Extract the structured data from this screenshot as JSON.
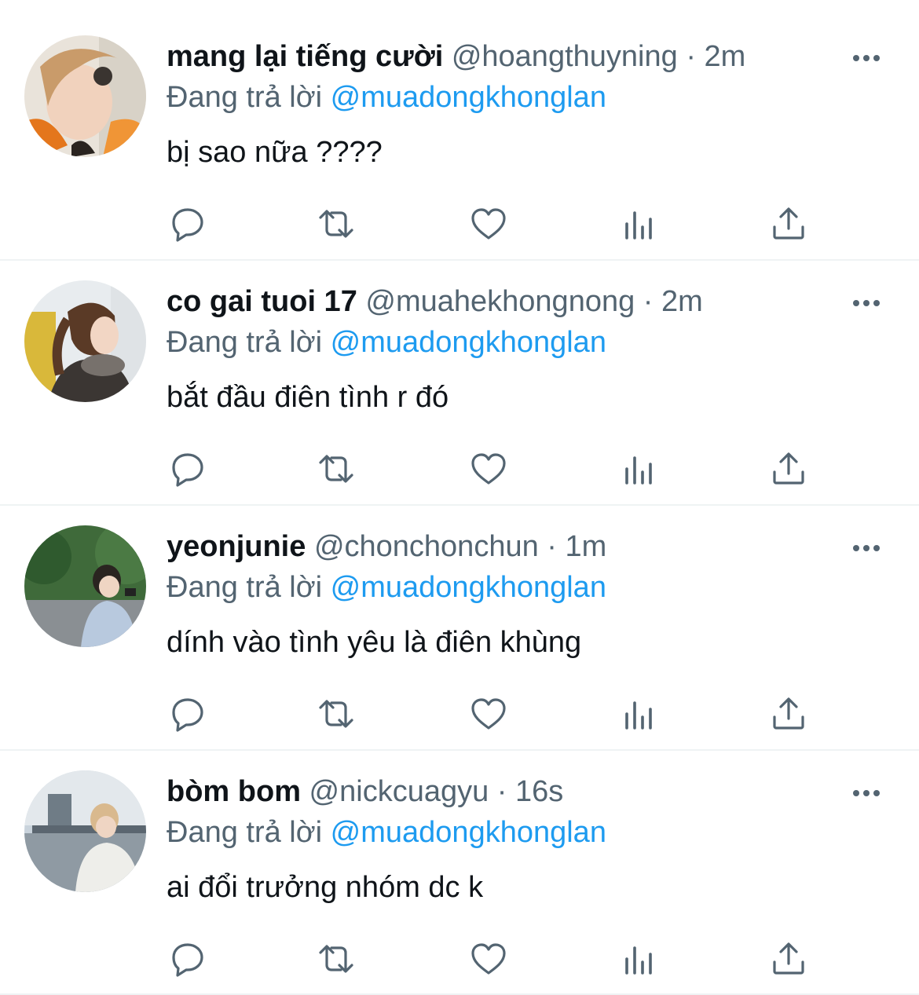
{
  "tweets": [
    {
      "display_name": "mang lại tiếng cười",
      "handle": "@hoangthuyning",
      "separator": "·",
      "time": "2m",
      "reply_prefix": "Đang trả lời",
      "reply_to": "@muadongkhonglan",
      "text": "bị sao nữa ????"
    },
    {
      "display_name": "co gai tuoi 17",
      "handle": "@muahekhongnong",
      "separator": "·",
      "time": "2m",
      "reply_prefix": "Đang trả lời",
      "reply_to": "@muadongkhonglan",
      "text": "bắt đầu điên tình r đó"
    },
    {
      "display_name": "yeonjunie",
      "handle": "@chonchonchun",
      "separator": "·",
      "time": "1m",
      "reply_prefix": "Đang trả lời",
      "reply_to": "@muadongkhonglan",
      "text": "dính vào tình yêu là điên khùng"
    },
    {
      "display_name": "bòm bom",
      "handle": "@nickcuagyu",
      "separator": "·",
      "time": "16s",
      "reply_prefix": "Đang trả lời",
      "reply_to": "@muadongkhonglan",
      "text": "ai đổi trưởng nhóm dc k"
    }
  ],
  "icons": {
    "more": "more-icon",
    "reply": "reply-icon",
    "retweet": "retweet-icon",
    "like": "heart-icon",
    "views": "views-icon",
    "share": "share-icon"
  },
  "colors": {
    "text": "#0f1419",
    "secondary": "#536471",
    "mention": "#1d9bf0",
    "divider": "#eff3f4"
  }
}
